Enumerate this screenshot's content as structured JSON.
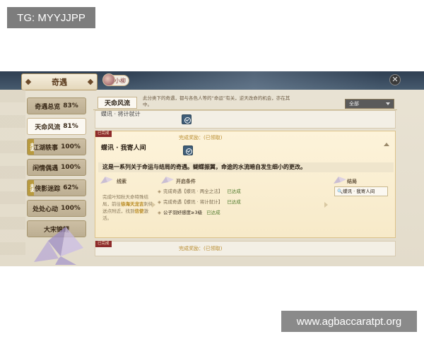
{
  "watermarks": {
    "top_left": "TG: MYYJJPP",
    "bottom_right": "www.agbaccaratpt.org"
  },
  "window": {
    "title": "奇遇",
    "avatar_label": "小柳",
    "close_label": "✕"
  },
  "menu": {
    "items": [
      {
        "label": "奇遇总览",
        "pct": "83%"
      },
      {
        "label": "天命风流",
        "pct": "81%"
      },
      {
        "label": "江湖轶事",
        "pct": "100%",
        "tag": "未读"
      },
      {
        "label": "闲情偶遇",
        "pct": "100%"
      },
      {
        "label": "侠影迷踪",
        "pct": "62%",
        "tag": "未读"
      },
      {
        "label": "处处心动",
        "pct": "100%"
      },
      {
        "label": "大宋锦鲤",
        "pct": ""
      }
    ]
  },
  "panel": {
    "tab_title": "天命风流",
    "tab_desc": "此分类下的奇遇，都与各色人等的“命运”有关，逆天改命的机会，亦在其中。",
    "filter_value": "全部",
    "prev_row_name": "蝶讯 · 将计就计",
    "card": {
      "status_badge": "已完成",
      "reward": "完成奖励：(已领取)",
      "name": "蝶讯 · 我寄人间",
      "description": "这是一系列关于命运与结局的奇遇。蝴蝶振翼，命途的水流暗自发生细小的更改。",
      "col_clue": "线索",
      "col_conditions": "开启条件",
      "col_ending": "结局",
      "clue_text_1": "完成叶知秋天命特殊结局，前往",
      "clue_hl_1": "徐海天龙吉",
      "clue_text_2": "刺侍送点附近，找到",
      "clue_hl_2": "信使",
      "clue_text_3": "激活。",
      "conditions": [
        {
          "text": "完成奇遇【蝶讯 · 两全之法】",
          "status": "已达成"
        },
        {
          "text": "完成奇遇【蝶讯 · 将计就计】",
          "status": "已达成"
        },
        {
          "text": "公子羽好感度≥3级",
          "status": "已达成"
        }
      ],
      "ending_value": "蝶讯 · 我寄人间"
    },
    "next_row": {
      "status_badge": "已完成",
      "reward": "完成奖励：(已领取)"
    }
  }
}
